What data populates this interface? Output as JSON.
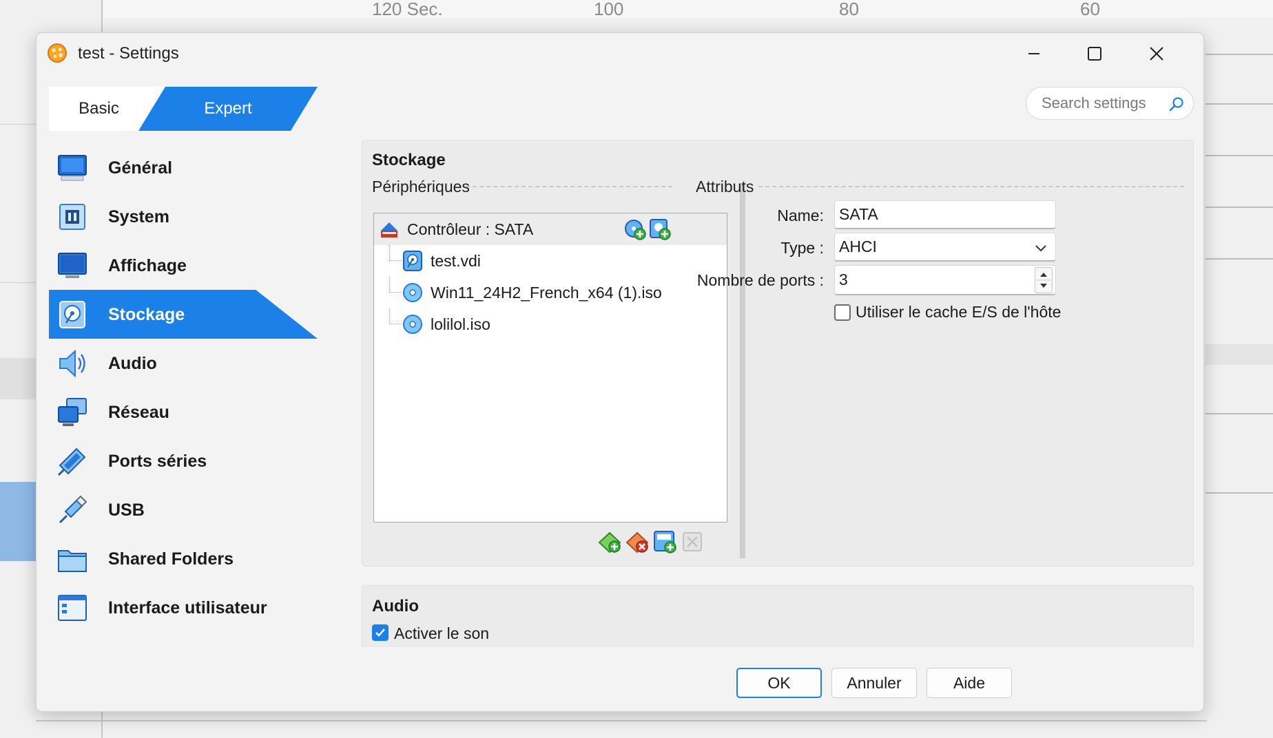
{
  "background": {
    "axis_ticks": [
      "120 Sec.",
      "100",
      "80",
      "60"
    ]
  },
  "window": {
    "title": "test - Settings",
    "controls": {
      "minimize": "minimize-icon",
      "maximize": "maximize-icon",
      "close": "close-icon"
    }
  },
  "mode_tabs": {
    "basic": "Basic",
    "expert": "Expert",
    "active": "expert"
  },
  "search": {
    "placeholder": "Search settings",
    "value": ""
  },
  "colors": {
    "accent": "#1b80e8",
    "panel": "#ebebeb",
    "selection": "#ececec"
  },
  "sidebar": {
    "active": "Stockage",
    "items": [
      {
        "label": "Général",
        "icon": "general-monitor-icon"
      },
      {
        "label": "System",
        "icon": "system-chip-icon"
      },
      {
        "label": "Affichage",
        "icon": "display-monitor-icon"
      },
      {
        "label": "Stockage",
        "icon": "storage-disk-icon"
      },
      {
        "label": "Audio",
        "icon": "audio-speaker-icon"
      },
      {
        "label": "Réseau",
        "icon": "network-icon"
      },
      {
        "label": "Ports séries",
        "icon": "serial-port-icon"
      },
      {
        "label": "USB",
        "icon": "usb-icon"
      },
      {
        "label": "Shared Folders",
        "icon": "shared-folder-icon"
      },
      {
        "label": "Interface utilisateur",
        "icon": "user-interface-icon"
      }
    ]
  },
  "storage": {
    "section_title": "Stockage",
    "devices_label": "Périphériques",
    "attributes_label": "Attributs",
    "tree": {
      "controller": "Contrôleur : SATA",
      "items": [
        {
          "label": "test.vdi",
          "icon": "hard-disk-icon"
        },
        {
          "label": "Win11_24H2_French_x64 (1).iso",
          "icon": "optical-disc-icon"
        },
        {
          "label": "lolilol.iso",
          "icon": "optical-disc-icon"
        }
      ]
    },
    "attributes": {
      "name_label": "Name:",
      "name_value": "SATA",
      "type_label": "Type :",
      "type_value": "AHCI",
      "ports_label": "Nombre de ports :",
      "ports_value": "3",
      "host_cache_label": "Utiliser le cache E/S de l'hôte",
      "host_cache_checked": false
    }
  },
  "audio": {
    "section_title": "Audio",
    "enable_label": "Activer le son",
    "enable_checked": true
  },
  "footer": {
    "ok": "OK",
    "cancel": "Annuler",
    "help": "Aide"
  }
}
